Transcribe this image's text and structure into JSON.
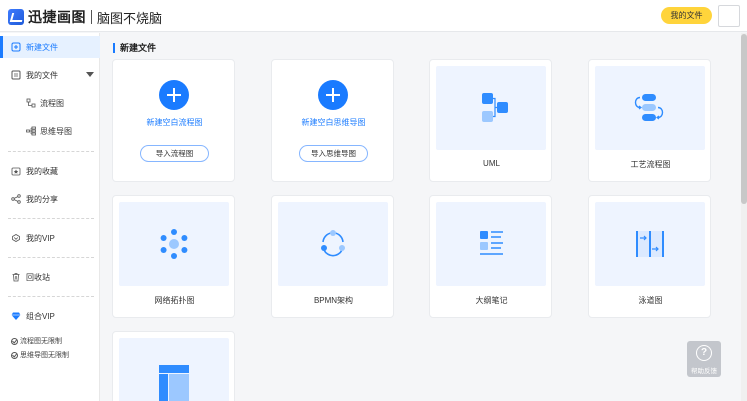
{
  "header": {
    "logo_text": "迅捷画图",
    "subtitle": "脑图不烧脑",
    "my_files_button": "我的文件"
  },
  "sidebar": {
    "new_file": "新建文件",
    "my_files": "我的文件",
    "flowchart": "流程图",
    "mindmap": "思维导图",
    "favorites": "我的收藏",
    "share": "我的分享",
    "vip": "我的VIP",
    "recycle": "回收站",
    "combo_vip": "组合VIP",
    "vip_notes": [
      "流程图无限制",
      "思维导图无限制"
    ]
  },
  "main": {
    "section_title": "新建文件",
    "blank_cards": [
      {
        "title": "新建空白流程图",
        "import_label": "导入流程图"
      },
      {
        "title": "新建空白思维导图",
        "import_label": "导入思维导图"
      }
    ],
    "templates": [
      {
        "label": "UML",
        "icon": "uml-icon"
      },
      {
        "label": "工艺流程图",
        "icon": "process-flow-icon"
      },
      {
        "label": "网络拓扑图",
        "icon": "network-topology-icon"
      },
      {
        "label": "BPMN架构",
        "icon": "bpmn-icon"
      },
      {
        "label": "大纲笔记",
        "icon": "outline-notes-icon"
      },
      {
        "label": "泳道图",
        "icon": "swimlane-icon"
      },
      {
        "label": "",
        "icon": "layout-icon"
      }
    ]
  },
  "help": {
    "label": "帮助反馈"
  },
  "colors": {
    "accent": "#1a7bff",
    "vip_yellow": "#ffd43b",
    "thumb_bg": "#eef4ff"
  }
}
